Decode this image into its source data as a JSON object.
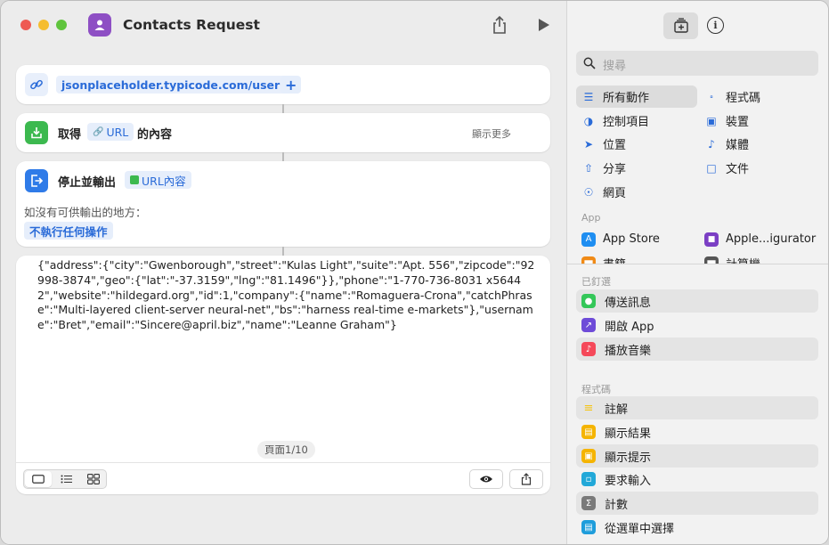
{
  "window": {
    "title": "Contacts Request"
  },
  "actions": {
    "url_text": "jsonplaceholder.typicode.com/users",
    "add_symbol": "+",
    "get": {
      "label": "取得",
      "token": "URL",
      "suffix": "的內容",
      "show_more": "顯示更多"
    },
    "stop": {
      "label": "停止並輸出",
      "token": "URL內容",
      "if_nowhere": "如沒有可供輸出的地方：",
      "do_nothing": "不執行任何操作"
    }
  },
  "output": {
    "json_text": "{\"address\":{\"city\":\"Gwenborough\",\"street\":\"Kulas Light\",\"suite\":\"Apt. 556\",\"zipcode\":\"92998-3874\",\"geo\":{\"lat\":\"-37.3159\",\"lng\":\"81.1496\"}},\"phone\":\"1-770-736-8031 x56442\",\"website\":\"hildegard.org\",\"id\":1,\"company\":{\"name\":\"Romaguera-Crona\",\"catchPhrase\":\"Multi-layered client-server neural-net\",\"bs\":\"harness real-time e-markets\"},\"username\":\"Bret\",\"email\":\"Sincere@april.biz\",\"name\":\"Leanne Graham\"}",
    "page": "頁面1/10"
  },
  "sidebar": {
    "search_placeholder": "搜尋",
    "categories": [
      {
        "label": "所有動作",
        "icon": "list-icon"
      },
      {
        "label": "程式碼",
        "icon": "code-icon"
      },
      {
        "label": "控制項目",
        "icon": "toggle-icon"
      },
      {
        "label": "裝置",
        "icon": "monitor-icon"
      },
      {
        "label": "位置",
        "icon": "location-icon"
      },
      {
        "label": "媒體",
        "icon": "music-note-icon"
      },
      {
        "label": "分享",
        "icon": "share-icon"
      },
      {
        "label": "文件",
        "icon": "document-icon"
      },
      {
        "label": "網頁",
        "icon": "compass-icon"
      }
    ],
    "app_section": "App",
    "apps": [
      {
        "label": "App Store"
      },
      {
        "label": "Apple...igurator"
      },
      {
        "label": "書籍"
      },
      {
        "label": "計算機"
      }
    ],
    "pinned_section": "已釘選",
    "pinned": [
      {
        "label": "傳送訊息",
        "color": "#34c759"
      },
      {
        "label": "開啟 App",
        "color": "#6e4bd8"
      },
      {
        "label": "播放音樂",
        "color": "#f5495a"
      }
    ],
    "scripting_section": "程式碼",
    "scripting": [
      {
        "label": "註解",
        "color": "#f5c518"
      },
      {
        "label": "顯示結果",
        "color": "#f5b400"
      },
      {
        "label": "顯示提示",
        "color": "#f5b400"
      },
      {
        "label": "要求輸入",
        "color": "#22a8d8"
      },
      {
        "label": "計數",
        "color": "#7a7a7a"
      },
      {
        "label": "從選單中選擇",
        "color": "#1f9ddb"
      }
    ]
  }
}
